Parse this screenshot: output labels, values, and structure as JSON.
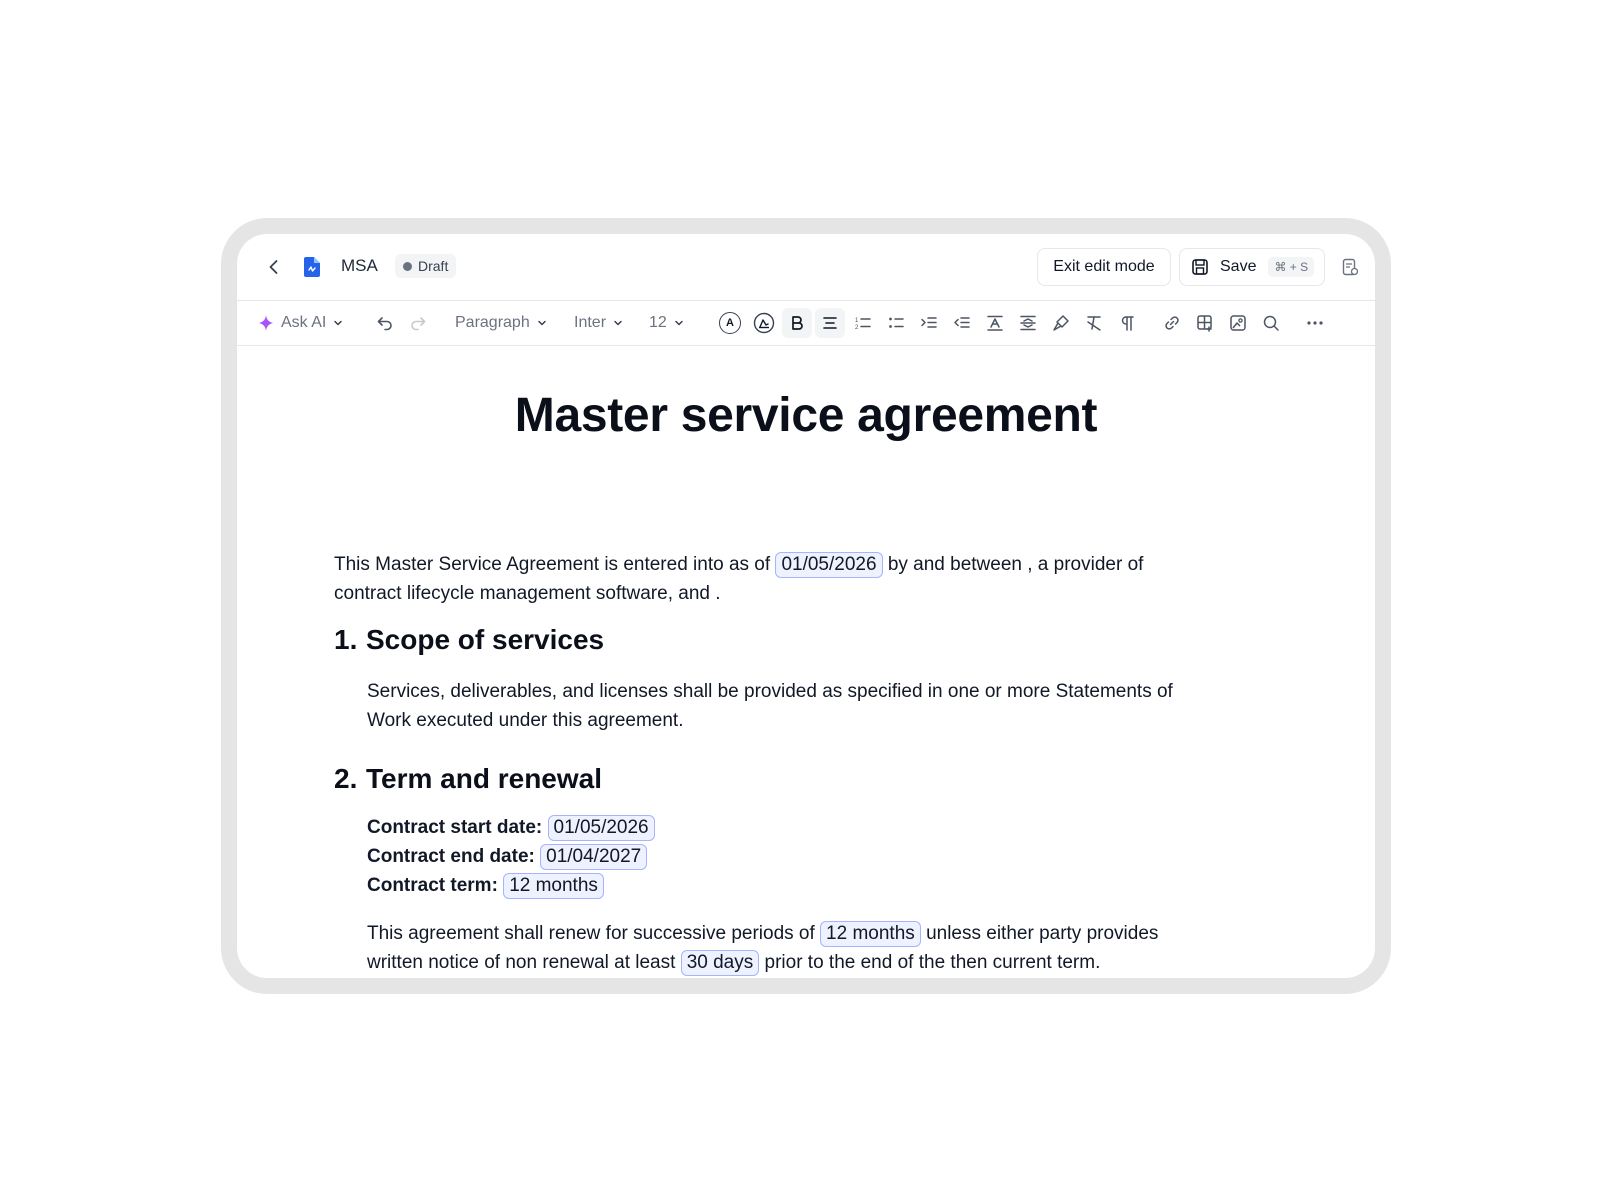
{
  "header": {
    "doc_name": "MSA",
    "status_badge": "Draft",
    "exit_button": "Exit edit mode",
    "save_button": "Save",
    "save_shortcut": "⌘ + S"
  },
  "toolbar": {
    "ask_ai": "Ask AI",
    "block_style": "Paragraph",
    "font": "Inter",
    "font_size": "12",
    "text_color_glyph": "A"
  },
  "document": {
    "title": "Master service agreement",
    "intro": {
      "before_date": "This Master Service Agreement is entered into as of",
      "date": "01/05/2026",
      "after_date": "by and between , a provider of",
      "line2": "contract lifecycle management software, and ."
    },
    "section1": {
      "number": "1.",
      "heading": "Scope of services",
      "line1": "Services, deliverables, and licenses shall be provided as specified in one or more Statements of",
      "line2": "Work executed under this agreement."
    },
    "section2": {
      "number": "2.",
      "heading": "Term and renewal",
      "fields": [
        {
          "label": "Contract start date:",
          "value": "01/05/2026"
        },
        {
          "label": "Contract end date:",
          "value": "01/04/2027"
        },
        {
          "label": "Contract term:",
          "value": "12 months"
        }
      ],
      "renewal": {
        "part1": "This agreement shall renew for successive periods of",
        "period": "12 months",
        "part2": "unless either party provides",
        "part3": "written notice of non renewal at least",
        "notice": "30 days",
        "part4": "prior to the end of the then current term."
      }
    }
  },
  "colors": {
    "chip_border": "#a5b4fc",
    "chip_fill": "#eef2ff",
    "doc_icon": "#2563eb",
    "ai_sparkle": "#a855f7"
  },
  "icons": [
    "back-icon",
    "document-icon",
    "save-icon",
    "side-panel-icon",
    "sparkle-icon",
    "undo-icon",
    "redo-icon",
    "text-color-icon",
    "highlight-icon",
    "bold-icon",
    "align-center-icon",
    "ordered-list-icon",
    "bullet-list-icon",
    "indent-icon",
    "outdent-icon",
    "text-format-icon",
    "line-height-icon",
    "format-painter-icon",
    "clear-format-icon",
    "pilcrow-icon",
    "link-icon",
    "table-icon",
    "image-icon",
    "search-icon",
    "more-icon"
  ]
}
